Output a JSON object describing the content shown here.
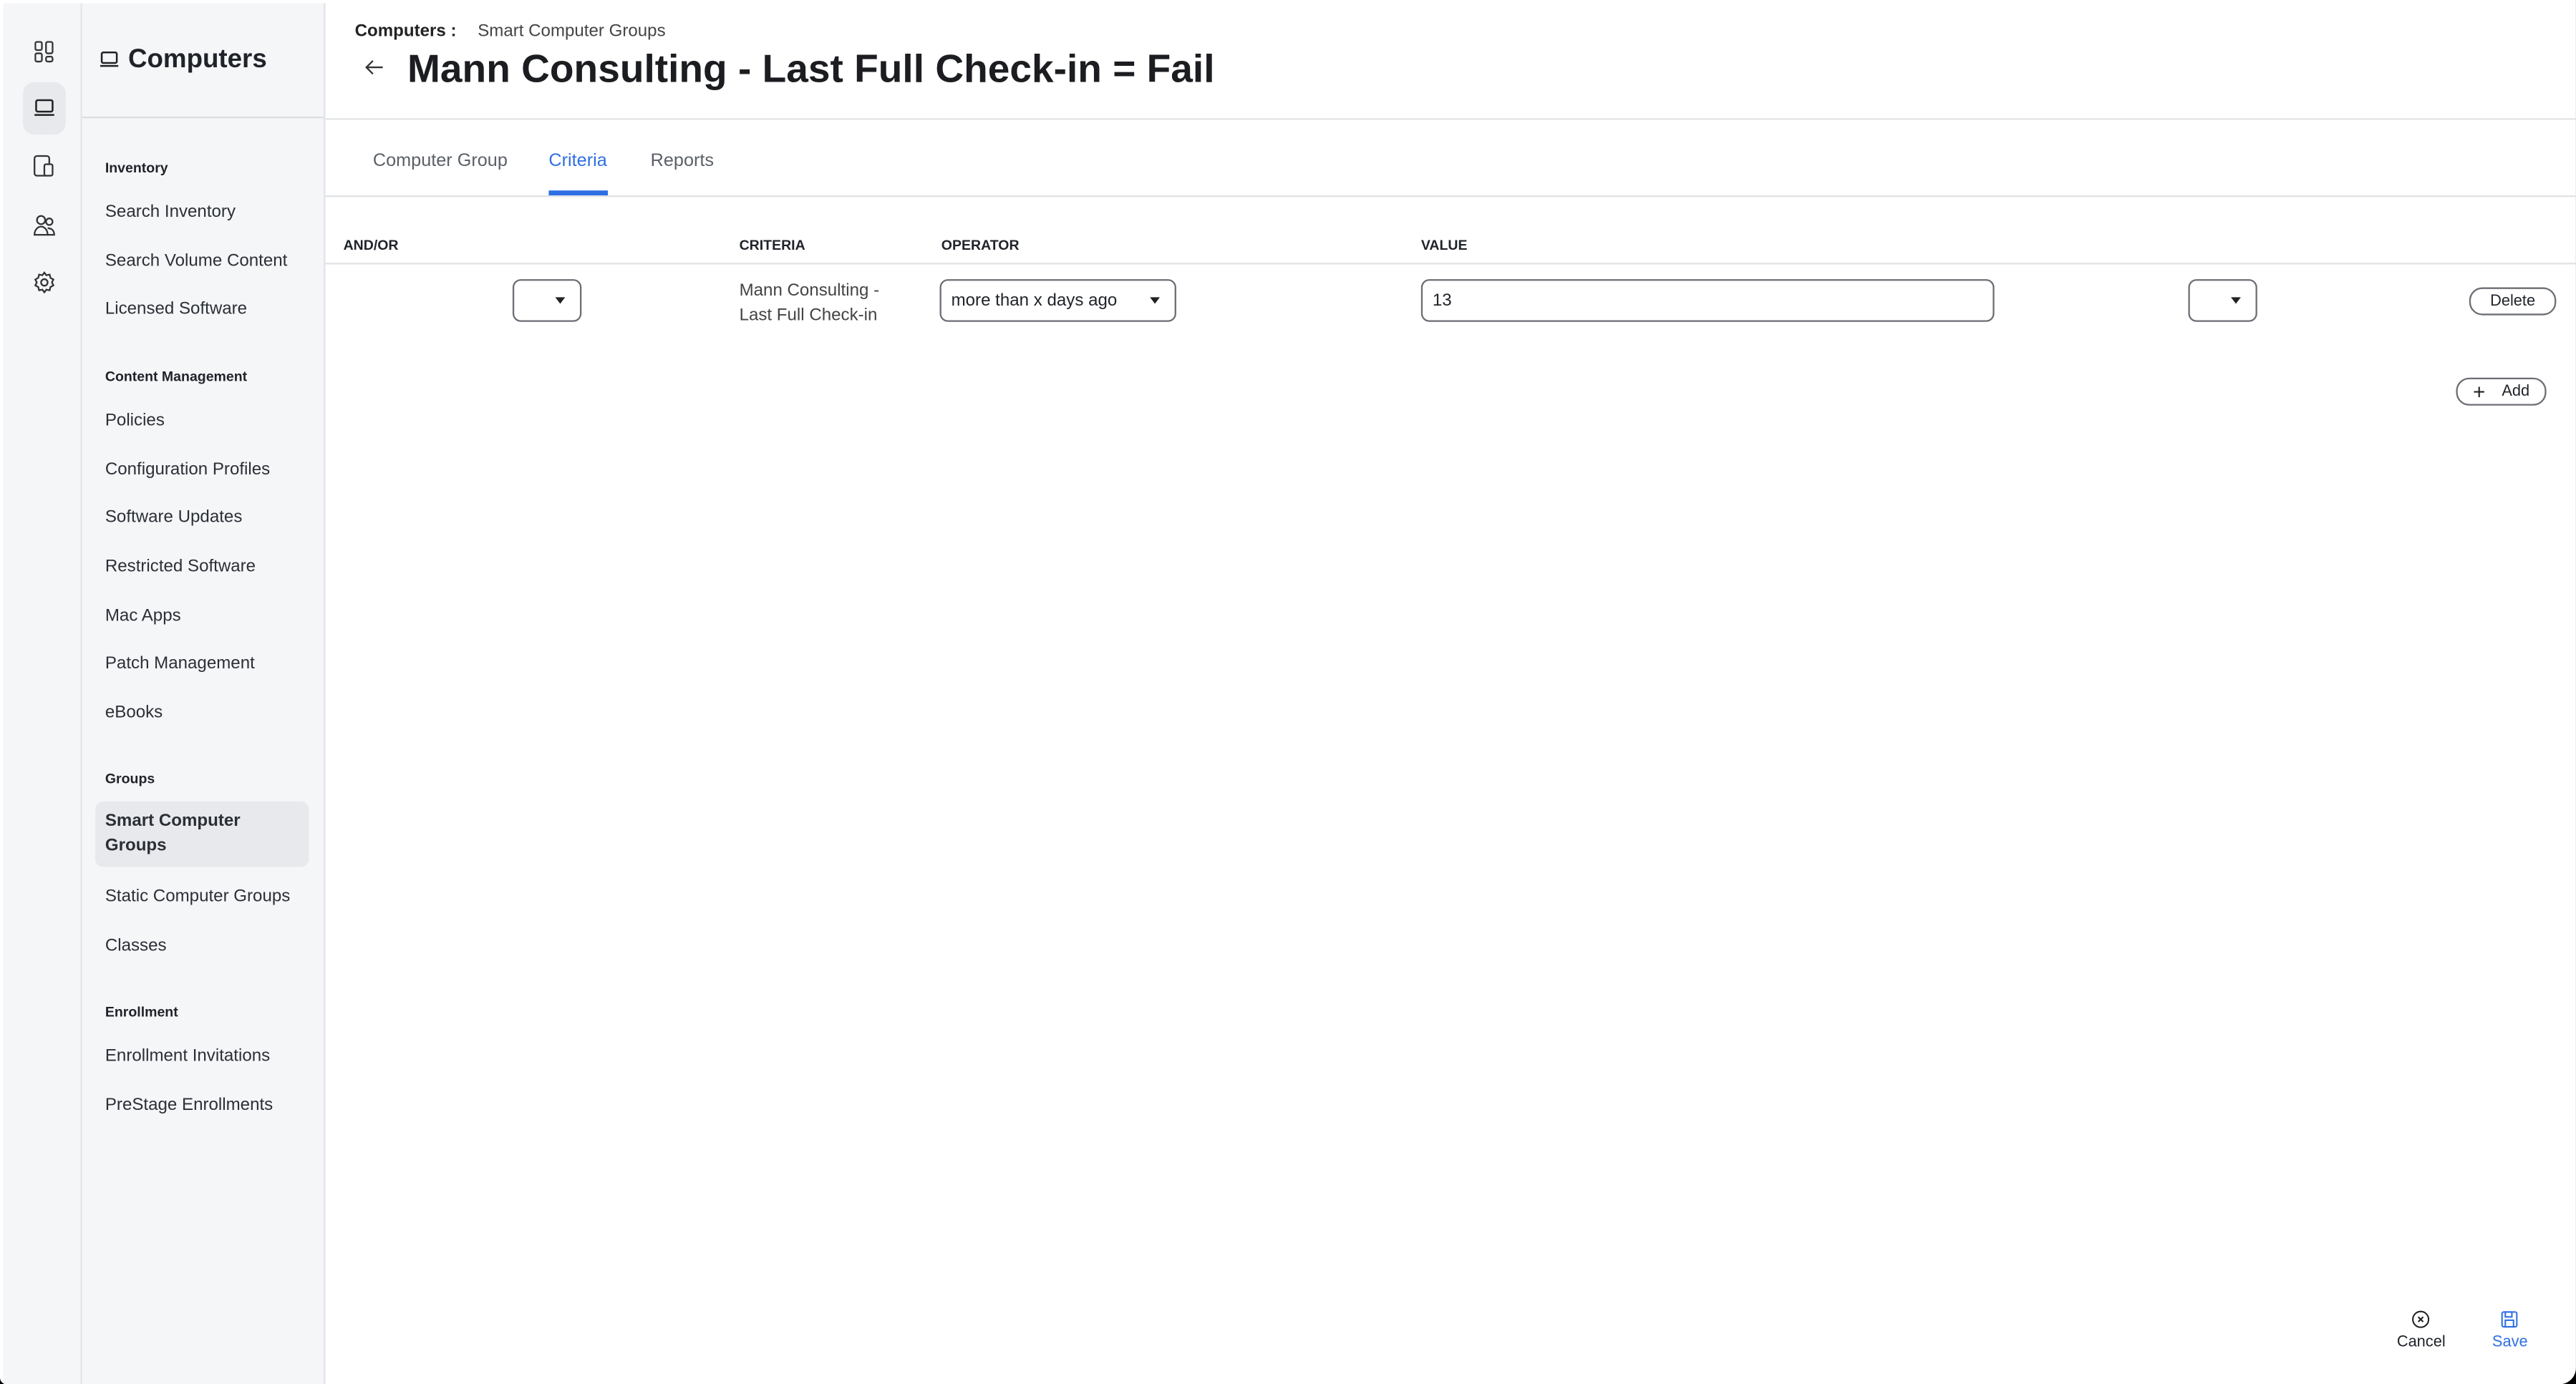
{
  "sidebar": {
    "title": "Computers",
    "sections": [
      {
        "label": "Inventory",
        "items": [
          "Search Inventory",
          "Search Volume Content",
          "Licensed Software"
        ]
      },
      {
        "label": "Content Management",
        "items": [
          "Policies",
          "Configuration Profiles",
          "Software Updates",
          "Restricted Software",
          "Mac Apps",
          "Patch Management",
          "eBooks"
        ]
      },
      {
        "label": "Groups",
        "items": [
          "Smart Computer Groups",
          "Static Computer Groups",
          "Classes"
        ]
      },
      {
        "label": "Enrollment",
        "items": [
          "Enrollment Invitations",
          "PreStage Enrollments"
        ]
      }
    ]
  },
  "header": {
    "breadcrumb_parent": "Computers :",
    "breadcrumb_current": "Smart Computer Groups",
    "title": "Mann Consulting - Last Full Check-in = Fail"
  },
  "tabs": [
    "Computer Group",
    "Criteria",
    "Reports"
  ],
  "table": {
    "headers": [
      "AND/OR",
      "CRITERIA",
      "OPERATOR",
      "VALUE"
    ],
    "rows": [
      {
        "and_or": "",
        "criteria_line1": "Mann Consulting -",
        "criteria_line2": "Last Full Check-in",
        "operator": "more than x days ago",
        "value": "13",
        "paren": "",
        "delete": "Delete"
      }
    ]
  },
  "add_label": "Add",
  "footer": {
    "cancel": "Cancel",
    "save": "Save"
  },
  "colors": {
    "accent": "#2f6fe4"
  }
}
